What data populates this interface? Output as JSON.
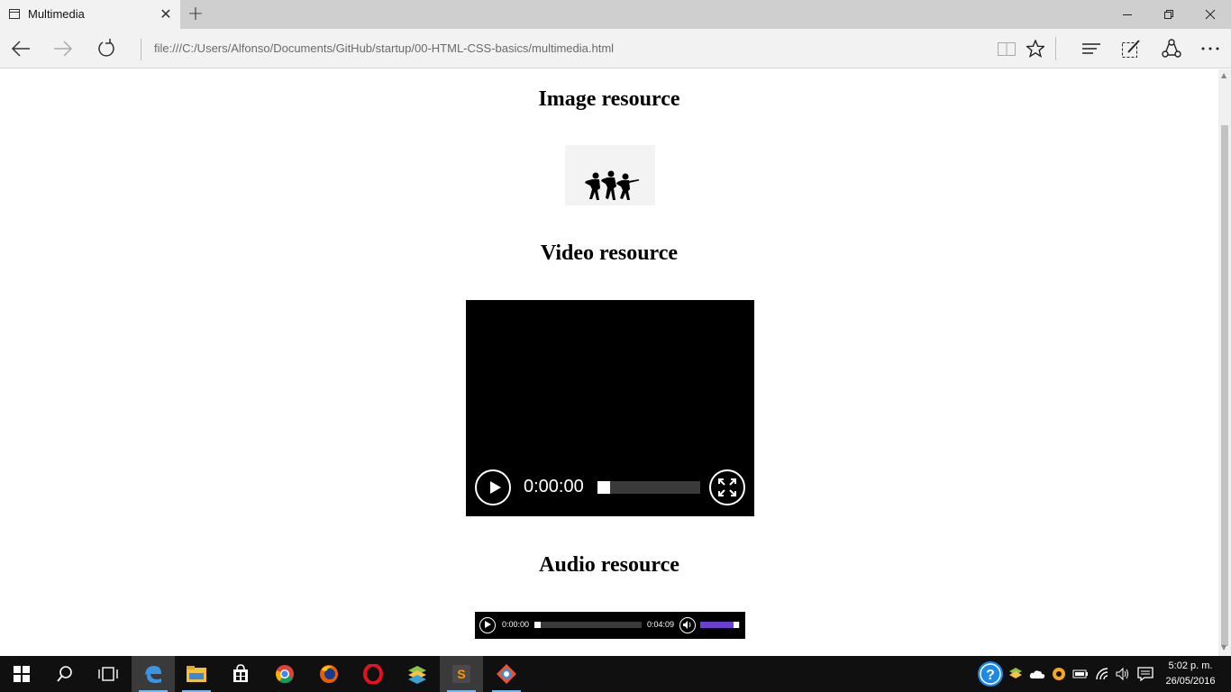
{
  "browser": {
    "tab_title": "Multimedia",
    "address": "file:///C:/Users/Alfonso/Documents/GitHub/startup/00-HTML-CSS-basics/multimedia.html",
    "new_tab": "+",
    "close_tab": "✕"
  },
  "page": {
    "image_heading": "Image resource",
    "video_heading": "Video resource",
    "audio_heading": "Audio resource"
  },
  "video": {
    "current_time": "0:00:00",
    "progress": 0
  },
  "audio": {
    "current_time": "0:00:00",
    "duration": "0:04:09",
    "progress": 0,
    "volume": 0.85,
    "volume_color": "#6b3fd0"
  },
  "taskbar": {
    "apps": [
      "start-icon",
      "search-icon",
      "task-view-icon",
      "edge-icon",
      "file-explorer-icon",
      "store-icon",
      "chrome-icon",
      "firefox-icon",
      "opera-icon",
      "bluestacks-icon",
      "sublime-text-icon",
      "git-icon"
    ],
    "time": "5:02 p. m.",
    "date": "26/05/2016"
  }
}
